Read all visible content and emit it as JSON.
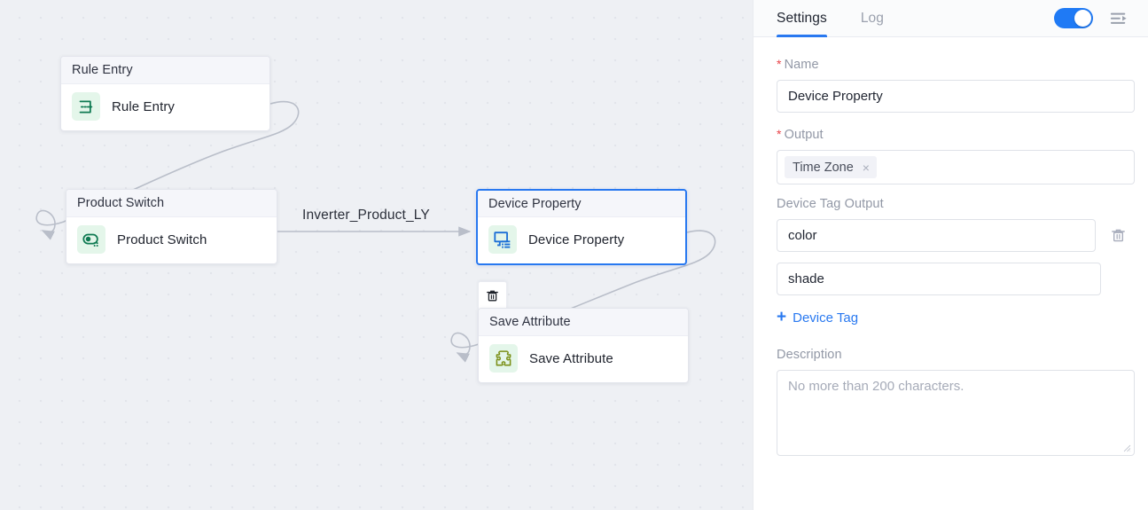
{
  "canvas": {
    "nodes": [
      {
        "id": "rule-entry",
        "title": "Rule Entry",
        "label": "Rule Entry",
        "icon": "rule-entry-icon",
        "selected": false
      },
      {
        "id": "product-switch",
        "title": "Product Switch",
        "label": "Product Switch",
        "icon": "product-switch-icon",
        "selected": false
      },
      {
        "id": "device-property",
        "title": "Device Property",
        "label": "Device Property",
        "icon": "device-property-icon",
        "selected": true
      },
      {
        "id": "save-attribute",
        "title": "Save Attribute",
        "label": "Save Attribute",
        "icon": "save-attribute-icon",
        "selected": false
      }
    ],
    "edges": [
      {
        "id": "edge-inverter",
        "label": "Inverter_Product_LY"
      }
    ],
    "delete_button_tooltip": "Delete"
  },
  "panel": {
    "tabs": [
      {
        "id": "settings",
        "label": "Settings",
        "active": true
      },
      {
        "id": "log",
        "label": "Log",
        "active": false
      }
    ],
    "toggle_on": true,
    "collapse_icon": "panel-collapse-icon",
    "fields": {
      "name": {
        "label": "Name",
        "required": true,
        "value": "Device Property"
      },
      "output": {
        "label": "Output",
        "required": true,
        "tags": [
          {
            "label": "Time Zone",
            "remove": "×"
          }
        ]
      },
      "device_tag_output": {
        "label": "Device Tag Output",
        "required": false,
        "rows": [
          {
            "value": "color",
            "has_delete": true
          },
          {
            "value": "shade",
            "has_delete": false
          }
        ],
        "add_label": "Device Tag",
        "add_icon": "plus-icon"
      },
      "description": {
        "label": "Description",
        "required": false,
        "value": "",
        "placeholder": "No more than 200 characters."
      }
    }
  },
  "colors": {
    "accent": "#2878f0",
    "required": "#e8454a",
    "canvas_bg": "#eef0f4",
    "node_icon_bg": "#e4f6ea",
    "edge": "#b9bec9"
  }
}
